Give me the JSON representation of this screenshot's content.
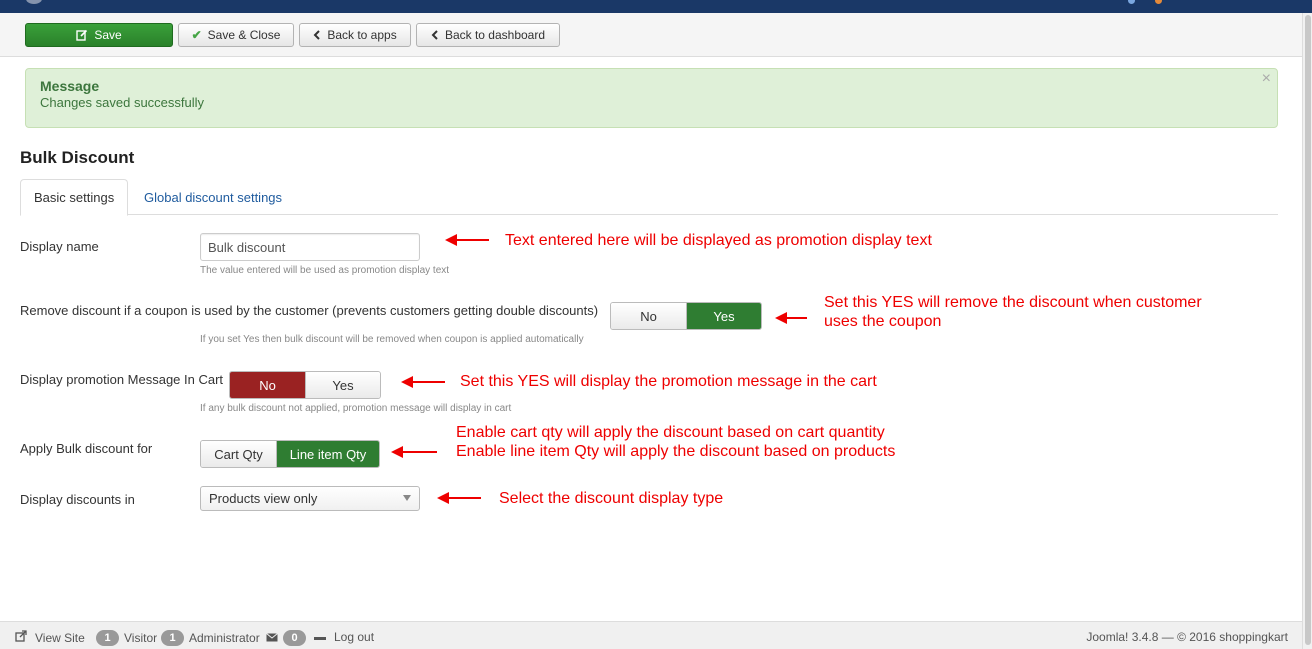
{
  "toolbar": {
    "save_label": "Save",
    "save_close_label": "Save & Close",
    "back_apps_label": "Back to apps",
    "back_dashboard_label": "Back to dashboard"
  },
  "alert": {
    "title": "Message",
    "text": "Changes saved successfully",
    "close": "×"
  },
  "page": {
    "title": "Bulk Discount"
  },
  "tabs": [
    {
      "label": "Basic settings",
      "active": true
    },
    {
      "label": "Global discount settings",
      "active": false
    }
  ],
  "form": {
    "display_name": {
      "label": "Display name",
      "value": "Bulk discount",
      "help": "The value entered will be used as promotion display text"
    },
    "remove_discount": {
      "label": "Remove discount if a coupon is used by the customer (prevents customers getting double discounts)",
      "options": [
        "No",
        "Yes"
      ],
      "selected": "Yes",
      "help": "If you set Yes then bulk discount will be removed when coupon is applied automatically"
    },
    "display_promo": {
      "label": "Display promotion Message In Cart",
      "options": [
        "No",
        "Yes"
      ],
      "selected": "No",
      "help": "If any bulk discount not applied, promotion message will display in cart"
    },
    "apply_for": {
      "label": "Apply Bulk discount for",
      "options": [
        "Cart Qty",
        "Line item Qty"
      ],
      "selected": "Line item Qty"
    },
    "display_in": {
      "label": "Display discounts in",
      "selected": "Products view only"
    }
  },
  "annotations": {
    "display_name": "Text entered here will be displayed as promotion display text",
    "remove_discount_line1": "Set this YES will remove the discount when customer",
    "remove_discount_line2": "uses the coupon",
    "display_promo": "Set this YES will display the promotion message in the cart",
    "apply_for_line1": "Enable cart qty will apply the discount based on cart quantity",
    "apply_for_line2": "Enable line item Qty will apply the discount based on products",
    "display_in": "Select the discount display type"
  },
  "footer": {
    "view_site": "View Site",
    "visitor_count": "1",
    "visitor_label": "Visitor",
    "admin_count": "1",
    "admin_label": "Administrator",
    "messages_count": "0",
    "logout": "Log out",
    "version": "Joomla! 3.4.8  —  © 2016 shoppingkart"
  },
  "colors": {
    "topbar": "#1a3867",
    "save_green": "#2f7d32",
    "toggle_red": "#9a2222",
    "annotation_red": "#ee0000",
    "alert_bg": "#dff0d8"
  }
}
